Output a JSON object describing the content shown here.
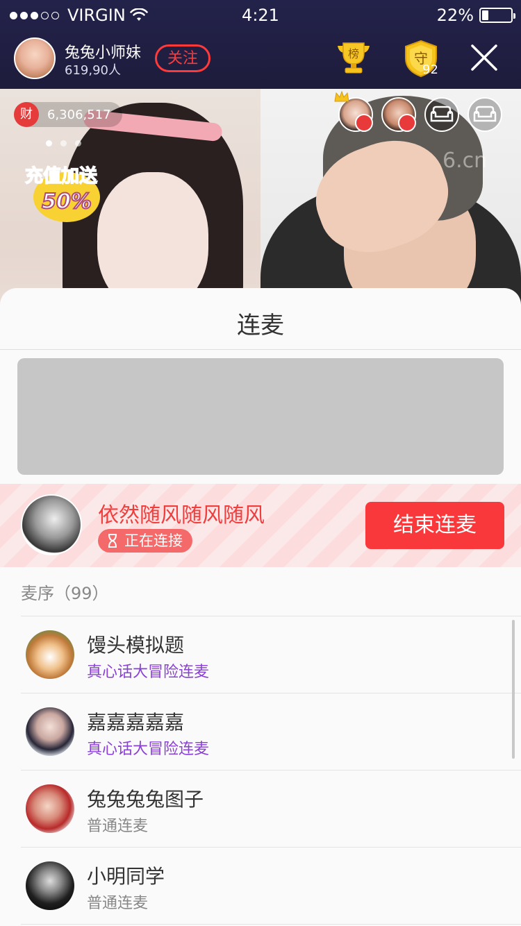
{
  "status_bar": {
    "carrier": "VIRGIN",
    "time": "4:21",
    "battery": "22%"
  },
  "live_header": {
    "host_name": "兔兔小师妹",
    "host_fans": "619,90人",
    "follow_label": "关注",
    "rank_icon_text": "榜",
    "guard_icon_text": "守",
    "guard_count": "92"
  },
  "video": {
    "wealth_badge": "财",
    "wealth_value": "6,306,517",
    "promo_line1": "充值加送",
    "promo_line2": "50%",
    "watermark": "6.cn"
  },
  "sheet": {
    "title": "连麦",
    "current": {
      "name": "依然随风随风随风",
      "status": "正在连接",
      "end_label": "结束连麦"
    },
    "queue_header": "麦序（99）",
    "queue": [
      {
        "name": "馒头模拟题",
        "mode": "真心话大冒险连麦"
      },
      {
        "name": "嘉嘉嘉嘉嘉",
        "mode": "真心话大冒险连麦"
      },
      {
        "name": "兔兔兔兔图子",
        "mode": "普通连麦"
      },
      {
        "name": "小明同学",
        "mode": "普通连麦"
      }
    ]
  },
  "colors": {
    "header_bg": "#23224a",
    "accent_red": "#f8383a",
    "purple_mode": "#8a3fd6",
    "gold": "#f5c31c"
  },
  "icons": [
    "wifi-icon",
    "trophy-icon",
    "guard-shield-icon",
    "close-icon",
    "sofa-icon",
    "hourglass-icon",
    "crown-icon"
  ]
}
